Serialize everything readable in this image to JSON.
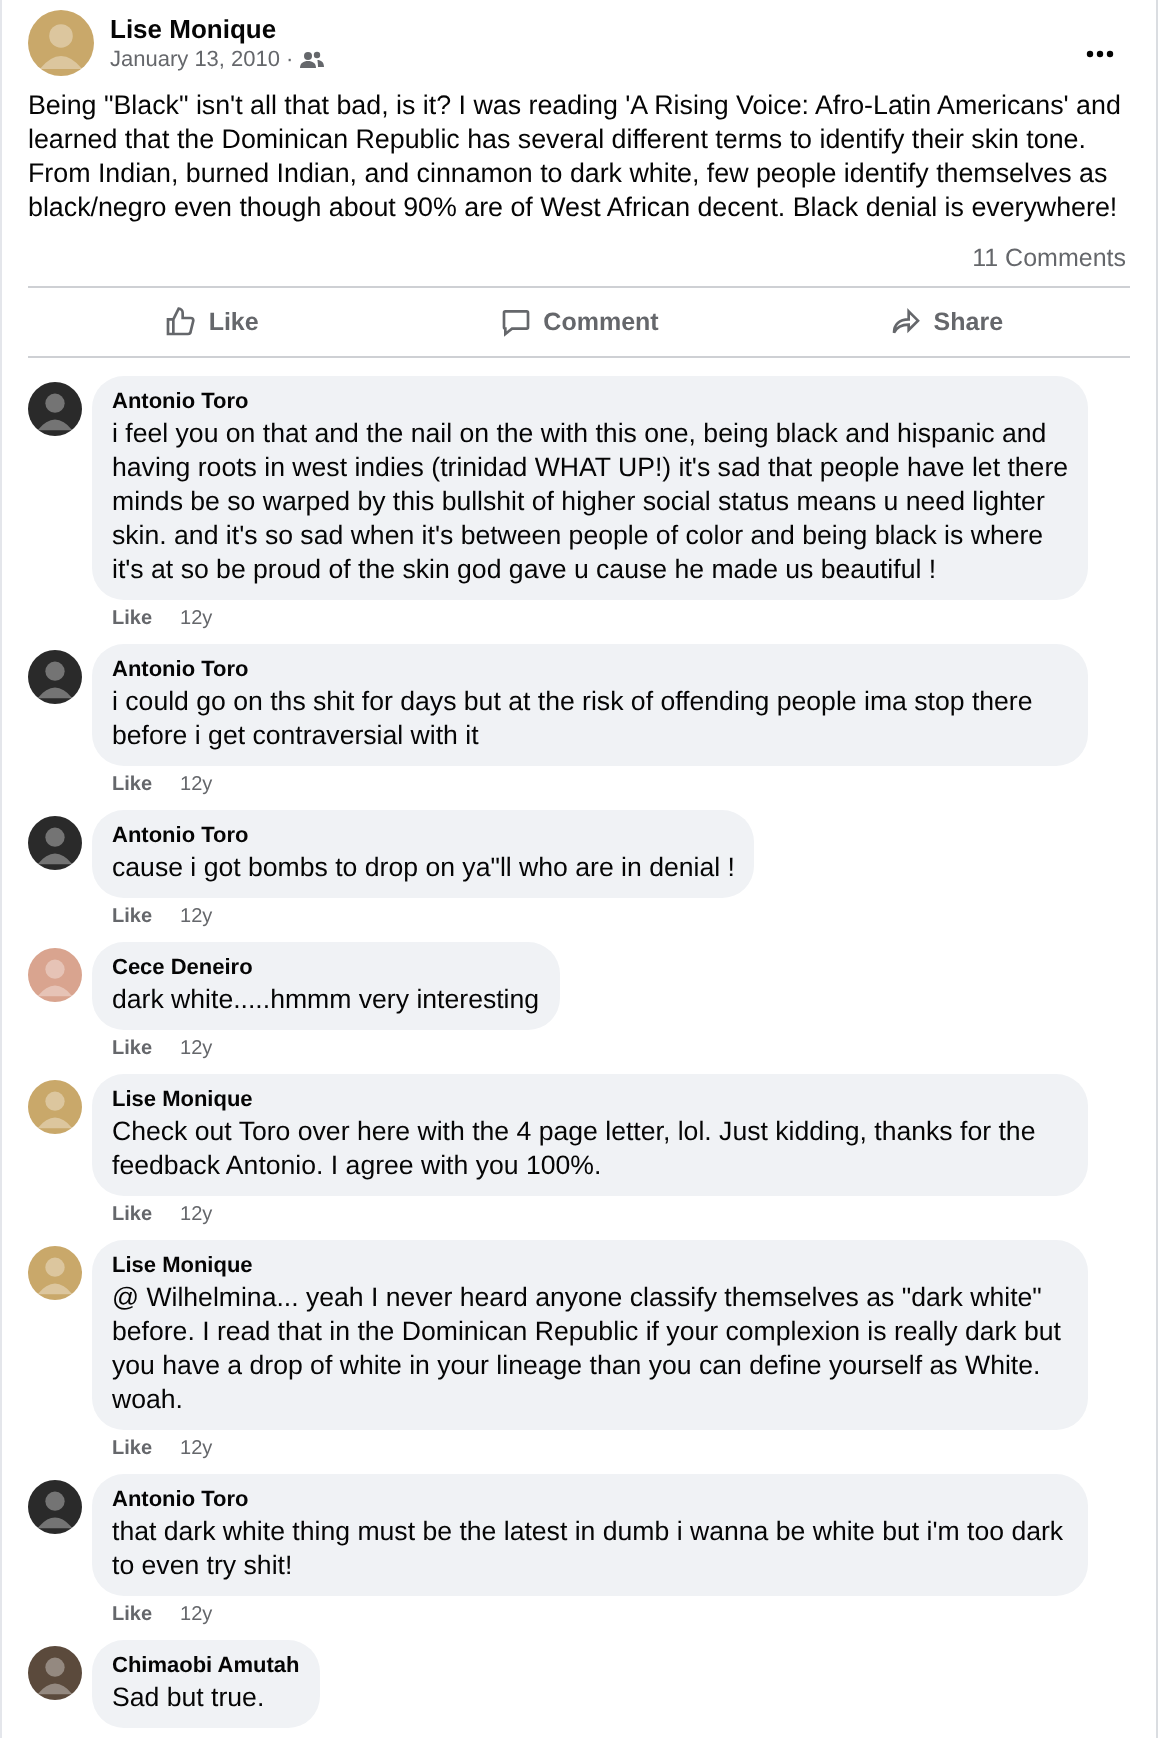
{
  "post": {
    "author": "Lise Monique",
    "date": "January 13, 2010",
    "separator": "·",
    "text": "Being \"Black\" isn't all that bad, is it? I was reading 'A Rising Voice: Afro-Latin Americans' and learned that the Dominican Republic has several different terms to identify their skin tone. From Indian, burned Indian, and cinnamon to dark white, few people identify themselves as black/negro even though about 90% are of West African decent. Black denial is everywhere!",
    "comment_count": "11 Comments"
  },
  "actions": [
    {
      "kind": "like",
      "label": "Like"
    },
    {
      "kind": "comment",
      "label": "Comment"
    },
    {
      "kind": "share",
      "label": "Share"
    }
  ],
  "comments": [
    {
      "author": "Antonio Toro",
      "color": "#2a2a2a",
      "text": "i feel you on that and the nail on the with this one, being black and hispanic and having roots in west indies (trinidad WHAT UP!) it's sad that people have let there minds be so warped by this bullshit of higher social status means u need lighter skin. and it's so sad when it's between people of color and being black is where it's at so be proud of the skin god gave u cause he made us beautiful !",
      "like": "Like",
      "age": "12y"
    },
    {
      "author": "Antonio Toro",
      "color": "#2a2a2a",
      "text": "i could go on ths shit for days but at the risk of offending people ima stop there before i get contraversial with it",
      "like": "Like",
      "age": "12y"
    },
    {
      "author": "Antonio Toro",
      "color": "#2a2a2a",
      "text": "cause i got bombs to drop on ya\"ll who are in denial !",
      "like": "Like",
      "age": "12y"
    },
    {
      "author": "Cece Deneiro",
      "color": "#d9a48f",
      "text": "dark white.....hmmm very interesting",
      "like": "Like",
      "age": "12y"
    },
    {
      "author": "Lise Monique",
      "color": "#c9a86a",
      "text": "Check out Toro over here with the 4 page letter, lol. Just kidding, thanks for the feedback Antonio. I agree with you 100%.",
      "like": "Like",
      "age": "12y"
    },
    {
      "author": "Lise Monique",
      "color": "#c9a86a",
      "text": "@ Wilhelmina... yeah I never heard anyone classify themselves as \"dark white\" before. I read that in the Dominican Republic if your complexion is really dark but you have a drop of white in your lineage than you can define yourself as White. woah.",
      "like": "Like",
      "age": "12y"
    },
    {
      "author": "Antonio Toro",
      "color": "#2a2a2a",
      "text": "that dark white thing must be the latest in dumb i wanna be white but i'm too dark to even try shit!",
      "like": "Like",
      "age": "12y"
    },
    {
      "author": "Chimaobi Amutah",
      "color": "#5b4a3c",
      "text": "Sad but true."
    }
  ]
}
